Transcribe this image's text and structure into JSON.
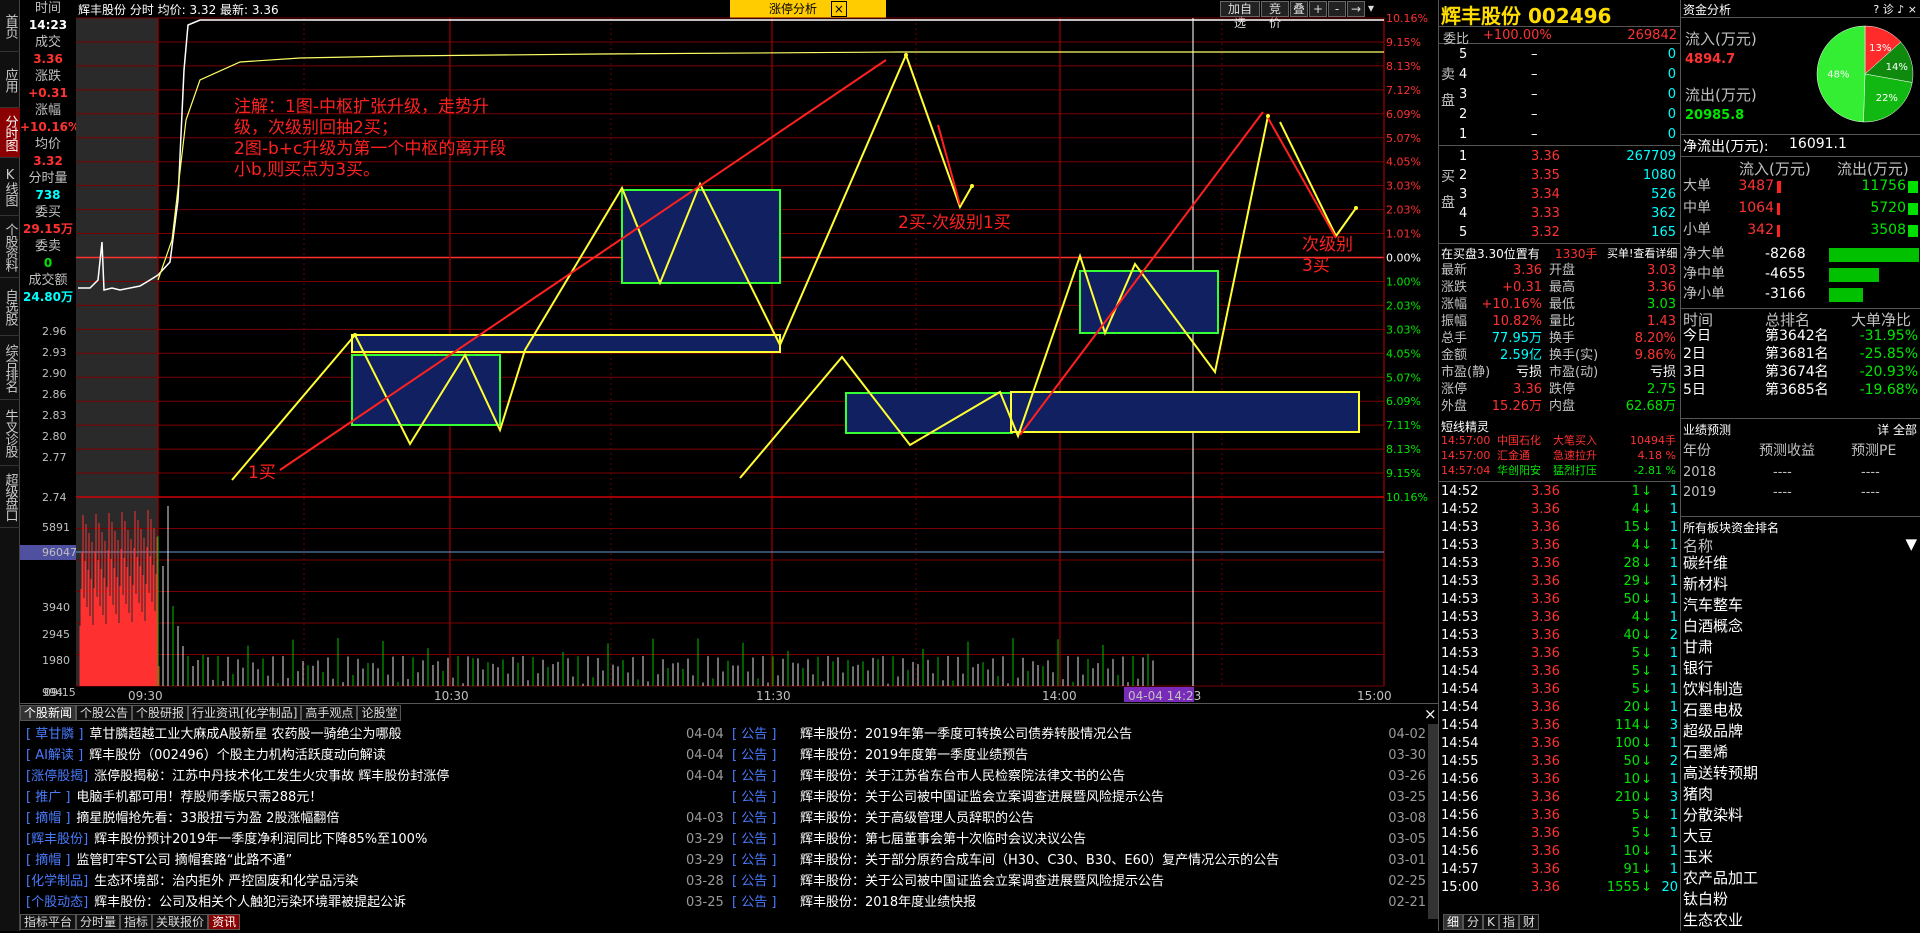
{
  "stock": {
    "name": "辉丰股份",
    "code": "002496",
    "title": "辉丰股份 002496"
  },
  "topbar": {
    "info": "辉丰股份 分时 均价: 3.32 最新: 3.36",
    "popup_label": "涨停分析",
    "close": "×",
    "btn_add": "加自选",
    "btn_auction": "竞价",
    "btn_stack": "叠",
    "ctrl_plus": "+",
    "ctrl_minus": "-",
    "ctrl_arrow": "→",
    "ctrl_menu": "▾"
  },
  "left_nav": [
    {
      "label": "首页",
      "active": false
    },
    {
      "label": "应用",
      "active": false
    },
    {
      "label": "分时图",
      "active": true
    },
    {
      "label": "K线图",
      "active": false
    },
    {
      "label": "个股资料",
      "active": false
    },
    {
      "label": "自选股",
      "active": false
    },
    {
      "label": "综合排名",
      "active": false
    },
    {
      "label": "牛叉诊股",
      "active": false
    },
    {
      "label": "超级盘口",
      "active": false
    }
  ],
  "cursor_panel": {
    "time_label": "时间",
    "time": "14:23",
    "price_label": "成交",
    "price": "3.36",
    "change_label": "涨跌",
    "change": "+0.31",
    "pct_label": "涨幅",
    "pct": "+10.16%",
    "avg_label": "均价",
    "avg": "3.32",
    "vol_label": "分时量",
    "vol": "738",
    "buy_label": "委买",
    "buy": "29.15万",
    "sell_label": "委卖",
    "sell": "0",
    "amt_label": "成交额",
    "amt": "24.80万"
  },
  "y_prices": [
    "2.96",
    "2.93",
    "2.90",
    "2.86",
    "2.83",
    "2.80",
    "2.77",
    "2.74"
  ],
  "y_pcts": [
    "10.16%",
    "9.15%",
    "8.13%",
    "7.12%",
    "6.09%",
    "5.07%",
    "4.05%",
    "3.03%",
    "2.03%",
    "1.01%",
    "0.00%",
    "1.00%",
    "2.03%",
    "3.03%",
    "4.05%",
    "5.07%",
    "6.09%",
    "7.11%",
    "8.13%",
    "9.15%",
    "10.16%"
  ],
  "vol_axis": [
    "5891",
    "96047",
    "3940",
    "2945",
    "1980",
    "994",
    "09:15"
  ],
  "x_axis": [
    "09:30",
    "10:30",
    "11:30",
    "14:00",
    "04-04 14:23",
    "15:00"
  ],
  "annotations": {
    "note": [
      "注解：1图-中枢扩张升级，走势升",
      "级，次级别回抽2买；",
      "2图-b+c升级为第一个中枢的离开段",
      "小b,则买点为3买。"
    ],
    "buy1": "1买",
    "buy2": "2买-次级别1买",
    "buy3a": "次级别",
    "buy3b": "3买"
  },
  "quote": {
    "wb_label": "委比",
    "wb_value": "+100.00%",
    "wb_diff": "269842",
    "sell_side": "卖盘",
    "buy_side": "买盘",
    "sells": [
      {
        "lv": "5",
        "p": "–",
        "v": "0"
      },
      {
        "lv": "4",
        "p": "–",
        "v": "0"
      },
      {
        "lv": "3",
        "p": "–",
        "v": "0"
      },
      {
        "lv": "2",
        "p": "–",
        "v": "0"
      },
      {
        "lv": "1",
        "p": "–",
        "v": "0"
      }
    ],
    "buys": [
      {
        "lv": "1",
        "p": "3.36",
        "v": "267709"
      },
      {
        "lv": "2",
        "p": "3.35",
        "v": "1080"
      },
      {
        "lv": "3",
        "p": "3.34",
        "v": "526"
      },
      {
        "lv": "4",
        "p": "3.33",
        "v": "362"
      },
      {
        "lv": "5",
        "p": "3.32",
        "v": "165"
      }
    ],
    "queue_text": "在买盘3.30位置有",
    "queue_qty": "1330手",
    "queue_link": "买单!查看详细",
    "stats": [
      [
        "最新",
        "3.36",
        "开盘",
        "3.03"
      ],
      [
        "涨跌",
        "+0.31",
        "最高",
        "3.36"
      ],
      [
        "涨幅",
        "+10.16%",
        "最低",
        "3.03"
      ],
      [
        "振幅",
        "10.82%",
        "量比",
        "1.43"
      ],
      [
        "总手",
        "77.95万",
        "换手",
        "8.20%"
      ],
      [
        "金额",
        "2.59亿",
        "换手(实)",
        "9.86%"
      ],
      [
        "市盈(静)",
        "亏损",
        "市盈(动)",
        "亏损"
      ],
      [
        "涨停",
        "3.36",
        "跌停",
        "2.75"
      ],
      [
        "外盘",
        "15.26万",
        "内盘",
        "62.68万"
      ]
    ],
    "short_title": "短线精灵",
    "short": [
      [
        "14:57:00",
        "中国石化",
        "大笔买入",
        "10494手"
      ],
      [
        "14:57:00",
        "汇金通",
        "急速拉升",
        "4.18 %"
      ],
      [
        "14:57:04",
        "华创阳安",
        "猛烈打压",
        "-2.81 %"
      ]
    ],
    "ticks": [
      [
        "14:52",
        "3.36",
        "1",
        ""
      ],
      [
        "14:52",
        "3.36",
        "4",
        ""
      ],
      [
        "14:53",
        "3.36",
        "15",
        ""
      ],
      [
        "14:53",
        "3.36",
        "4",
        ""
      ],
      [
        "14:53",
        "3.36",
        "28",
        ""
      ],
      [
        "14:53",
        "3.36",
        "29",
        ""
      ],
      [
        "14:53",
        "3.36",
        "50",
        ""
      ],
      [
        "14:53",
        "3.36",
        "4",
        ""
      ],
      [
        "14:53",
        "3.36",
        "40",
        "2"
      ],
      [
        "14:53",
        "3.36",
        "5",
        ""
      ],
      [
        "14:54",
        "3.36",
        "5",
        ""
      ],
      [
        "14:54",
        "3.36",
        "5",
        ""
      ],
      [
        "14:54",
        "3.36",
        "20",
        ""
      ],
      [
        "14:54",
        "3.36",
        "114",
        "3"
      ],
      [
        "14:54",
        "3.36",
        "100",
        ""
      ],
      [
        "14:55",
        "3.36",
        "50",
        "2"
      ],
      [
        "14:56",
        "3.36",
        "10",
        ""
      ],
      [
        "14:56",
        "3.36",
        "210",
        "3"
      ],
      [
        "14:56",
        "3.36",
        "5",
        ""
      ],
      [
        "14:56",
        "3.36",
        "5",
        ""
      ],
      [
        "14:56",
        "3.36",
        "10",
        ""
      ],
      [
        "14:57",
        "3.36",
        "91",
        ""
      ],
      [
        "15:00",
        "3.36",
        "1555",
        "20"
      ]
    ],
    "bottom_tabs": [
      "细",
      "分",
      "K",
      "指",
      "财"
    ]
  },
  "funds": {
    "title": "资金分析",
    "in_label": "流入(万元)",
    "in_value": "4894.7",
    "out_label": "流出(万元)",
    "out_value": "20985.8",
    "net_label": "净流出(万元):",
    "net_value": "16091.1",
    "pie": [
      {
        "label": "13%",
        "value": 13,
        "color": "#ff2a2a"
      },
      {
        "label": "14%",
        "value": 14,
        "color": "#0f8a0f"
      },
      {
        "label": "22%",
        "value": 22,
        "color": "#12b812"
      },
      {
        "label": "48%",
        "value": 48,
        "color": "#33ee33"
      }
    ],
    "col_in": "流入(万元)",
    "col_out": "流出(万元)",
    "sizes": [
      {
        "name": "大单",
        "in": "3487",
        "out": "11756",
        "in_frac": 0.3,
        "out_frac": 1.0
      },
      {
        "name": "中单",
        "in": "1064",
        "out": "5720",
        "in_frac": 0.09,
        "out_frac": 0.49
      },
      {
        "name": "小单",
        "in": "342",
        "out": "3508",
        "in_frac": 0.03,
        "out_frac": 0.3
      }
    ],
    "nets": [
      {
        "name": "净大单",
        "value": "-8268",
        "frac": 1.0
      },
      {
        "name": "净中单",
        "value": "-4655",
        "frac": 0.56
      },
      {
        "name": "净小单",
        "value": "-3166",
        "frac": 0.38
      }
    ],
    "rank_head": [
      "时间",
      "总排名",
      "大单净比"
    ],
    "ranks": [
      [
        "今日",
        "第3642名",
        "-31.95%"
      ],
      [
        "2日",
        "第3681名",
        "-25.85%"
      ],
      [
        "3日",
        "第3674名",
        "-20.93%"
      ],
      [
        "5日",
        "第3685名",
        "-19.68%"
      ]
    ],
    "forecast_title": "业绩预测",
    "forecast_link": "详 全部",
    "forecast_head": [
      "年份",
      "预测收益",
      "预测PE"
    ],
    "forecast": [
      [
        "2018",
        "----",
        "----"
      ],
      [
        "2019",
        "----",
        "----"
      ]
    ],
    "sector_title": "所有板块资金排名",
    "sector_head": "名称",
    "sectors": [
      "碳纤维",
      "新材料",
      "汽车整车",
      "白酒概念",
      "甘肃",
      "银行",
      "饮料制造",
      "石墨电极",
      "超级品牌",
      "石墨烯",
      "高送转预期",
      "猪肉",
      "分散染料",
      "大豆",
      "玉米",
      "农产品加工",
      "钛白粉",
      "生态农业"
    ]
  },
  "news_tabs": [
    "个股新闻",
    "个股公告",
    "个股研报",
    "行业资讯[化学制品]",
    "高手观点",
    "论股堂"
  ],
  "news_left": [
    [
      "[ 草甘膦 ]",
      "草甘膦超越工业大麻成A股新星 农药股一骑绝尘为哪般",
      ""
    ],
    [
      "[ AI解读 ]",
      "辉丰股份（002496）个股主力机构活跃度动向解读",
      ""
    ],
    [
      "[涨停股揭]",
      "涨停股揭秘：江苏中丹技术化工发生火灾事故 辉丰股份封涨停",
      ""
    ],
    [
      "[ 推广 ]",
      "电脑手机都可用！荐股师季版只需288元！",
      ""
    ],
    [
      "[ 摘帽 ]",
      "摘星脱帽抢先看：33股扭亏为盈 2股涨幅翻倍",
      "04-03"
    ],
    [
      "[辉丰股份]",
      "辉丰股份预计2019年一季度净利润同比下降85%至100%",
      "03-29"
    ],
    [
      "[ 摘帽 ]",
      "监管盯牢ST公司 摘帽套路“此路不通”",
      "03-29"
    ],
    [
      "[化学制品]",
      "生态环境部：治内拒外 严控固废和化学品污染",
      "03-28"
    ],
    [
      "[个股动态]",
      "辉丰股份：公司及相关个人触犯污染环境罪被提起公诉",
      "03-25"
    ]
  ],
  "news_right": [
    [
      "04-04",
      "[ 公告 ]",
      "辉丰股份：2019年第一季度可转换公司债券转股情况公告",
      "04-02"
    ],
    [
      "04-04",
      "[ 公告 ]",
      "辉丰股份：2019年度第一季度业绩预告",
      "03-30"
    ],
    [
      "04-04",
      "[ 公告 ]",
      "辉丰股份：关于江苏省东台市人民检察院法律文书的公告",
      "03-26"
    ],
    [
      "",
      "[ 公告 ]",
      "辉丰股份：关于公司被中国证监会立案调查进展暨风险提示公告",
      "03-25"
    ],
    [
      "",
      "[ 公告 ]",
      "辉丰股份：关于高级管理人员辞职的公告",
      "03-08"
    ],
    [
      "",
      "[ 公告 ]",
      "辉丰股份：第七届董事会第十次临时会议决议公告",
      "03-05"
    ],
    [
      "",
      "[ 公告 ]",
      "辉丰股份：关于部分原药合成车间（H30、C30、B30、E60）复产情况公示的公告",
      "03-01"
    ],
    [
      "",
      "[ 公告 ]",
      "辉丰股份：关于公司被中国证监会立案调查进展暨风险提示公告",
      "02-25"
    ],
    [
      "",
      "[ 公告 ]",
      "辉丰股份：2018年度业绩快报",
      "02-21"
    ]
  ],
  "bottom_tabs": [
    "指标平台",
    "分时量",
    "指标",
    "关联报价",
    "资讯"
  ]
}
